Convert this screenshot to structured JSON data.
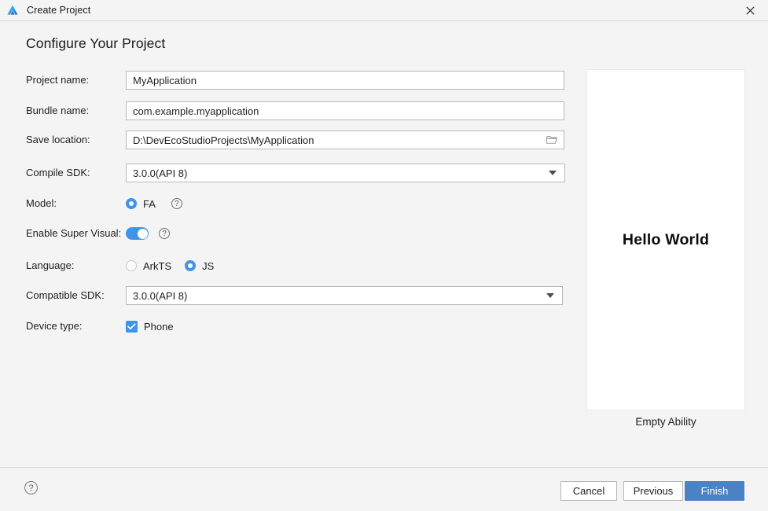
{
  "window": {
    "title": "Create Project",
    "logo_icon": "deveco-studio-logo-icon",
    "close_icon": "close-icon"
  },
  "page": {
    "heading": "Configure Your Project"
  },
  "form": {
    "fields": [
      {
        "label": "Project name:",
        "type": "text",
        "value": "MyApplication",
        "placeholder": "Project name"
      },
      {
        "label": "Bundle name:",
        "type": "text",
        "value": "com.example.myapplication",
        "placeholder": "Bundle name"
      },
      {
        "label": "Save location:",
        "type": "path",
        "value": "D:\\DevEcoStudioProjects\\MyApplication",
        "placeholder": "Save location",
        "trailing_icon": "folder-icon"
      },
      {
        "label": "Compile SDK:",
        "type": "combo",
        "value": "3.0.0(API 8)",
        "trailing_icon": "chevron-down-icon"
      },
      {
        "label": "Model:",
        "type": "radio-group",
        "options": [
          {
            "label": "FA",
            "selected": true
          }
        ],
        "help_icon": "help-icon"
      },
      {
        "label": "Enable Super Visual:",
        "type": "toggle",
        "state": "on",
        "help_icon": "help-icon"
      },
      {
        "label": "Language:",
        "type": "radio-group",
        "options": [
          {
            "label": "ArkTS",
            "selected": false
          },
          {
            "label": "JS",
            "selected": true
          }
        ]
      },
      {
        "label": "Compatible SDK:",
        "type": "combo",
        "value": "3.0.0(API 8)",
        "trailing_icon": "chevron-down-icon"
      },
      {
        "label": "Device type:",
        "type": "checkbox-group",
        "options": [
          {
            "label": "Phone",
            "checked": true
          }
        ]
      }
    ]
  },
  "preview": {
    "screen_text": "Hello World",
    "caption": "Empty Ability"
  },
  "footer": {
    "help_icon": "help-icon",
    "buttons": {
      "cancel": "Cancel",
      "previous": "Previous",
      "finish": "Finish"
    }
  },
  "colors": {
    "accent": "#3f93e8",
    "primary_button": "#4a82c4",
    "dialog_bg": "#f4f4f4",
    "field_bg": "#ffffff",
    "field_border": "#b8b8b8"
  }
}
